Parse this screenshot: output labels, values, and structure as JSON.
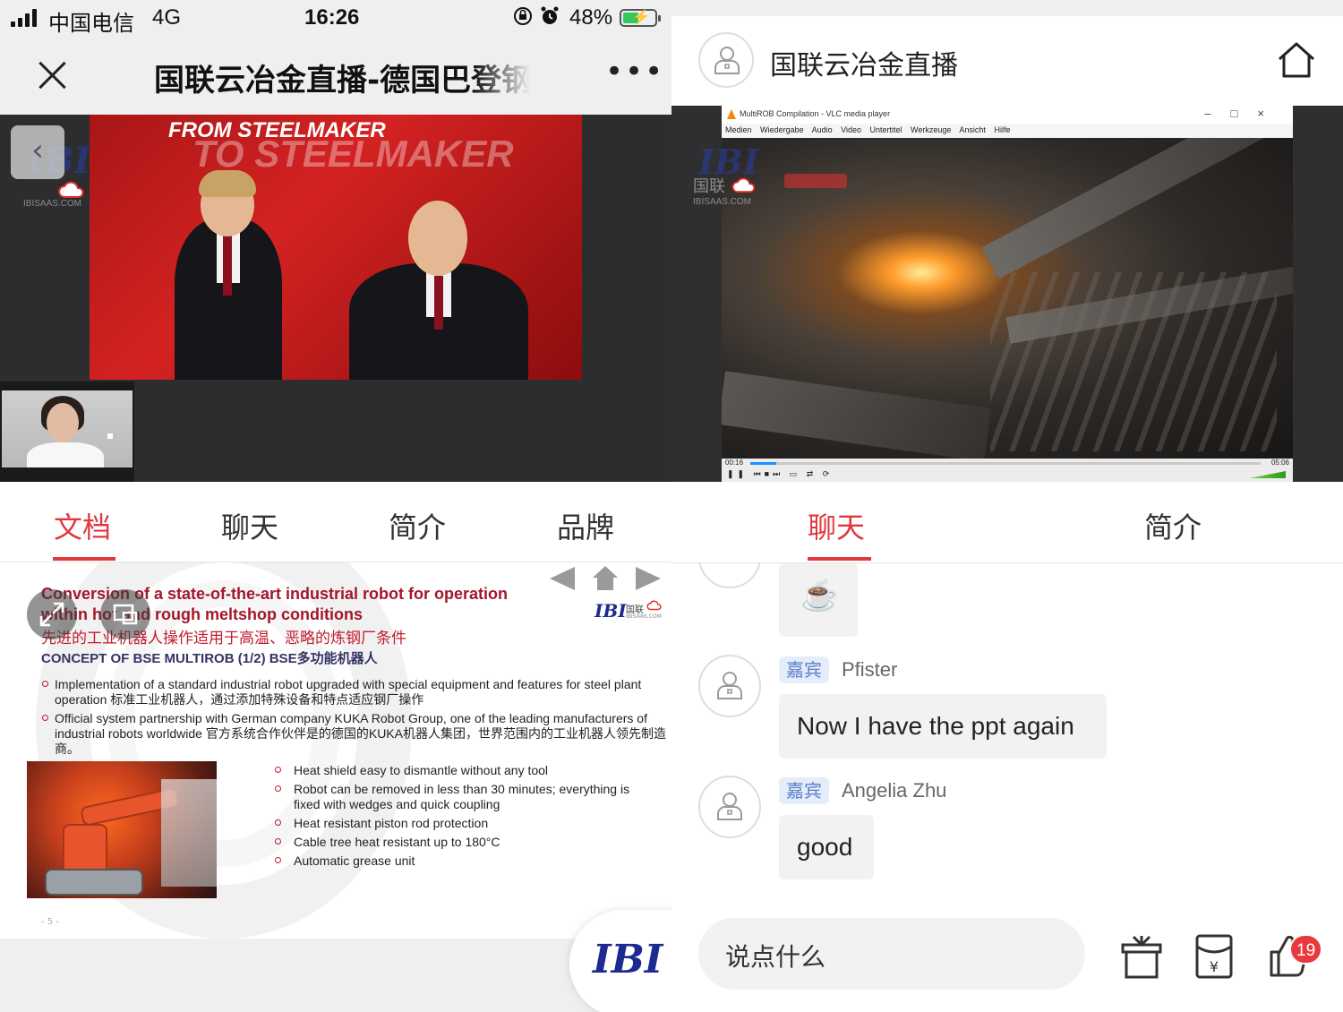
{
  "status_bar": {
    "carrier": "中国电信",
    "network": "4G",
    "time": "16:26",
    "battery": "48%"
  },
  "left_nav": {
    "title": "国联云冶金直播-德国巴登钢"
  },
  "left_video": {
    "stage_line1": "FROM STEELMAKER",
    "stage_line2": "TO STEELMAKER",
    "watermark_logo": "IBI",
    "watermark_domain": "IBISAAS.COM"
  },
  "left_tabs": [
    "文档",
    "聊天",
    "简介",
    "品牌"
  ],
  "document": {
    "title_en": "Conversion of a state-of-the-art industrial robot for operation within hot and rough meltshop conditions",
    "title_cn": "先进的工业机器人操作适用于高温、恶略的炼钢厂条件",
    "concept": "CONCEPT OF BSE MULTIROB (1/2) BSE多功能机器人",
    "logo": "IBI",
    "logo_cn": "国联",
    "logo_domain": "IBISAAS.COM",
    "bullets": [
      "Implementation of a standard industrial robot upgraded with special equipment and features for steel plant operation 标准工业机器人，通过添加特殊设备和特点适应钢厂操作",
      "Official system partnership with German company KUKA Robot Group, one of the leading manufacturers of industrial robots worldwide 官方系统合作伙伴是的德国的KUKA机器人集团，世界范围内的工业机器人领先制造商。"
    ],
    "features": [
      "Heat shield easy to dismantle without any tool",
      "Robot can be removed in less than 30 minutes; everything is fixed with wedges and quick coupling",
      "Heat resistant piston rod protection",
      "Cable tree heat resistant up to 180°C",
      "Automatic grease unit"
    ],
    "page_num": "- 5 -"
  },
  "float_logo": "IBI",
  "right_header": {
    "title": "国联云冶金直播"
  },
  "vlc": {
    "title": "MultiROB Compilation - VLC media player",
    "menu": [
      "Medien",
      "Wiedergabe",
      "Audio",
      "Video",
      "Untertitel",
      "Werkzeuge",
      "Ansicht",
      "Hilfe"
    ],
    "time_elapsed": "00:16",
    "time_total": "05:06",
    "progress": 0.05,
    "watermark_logo": "IBI",
    "watermark_cn": "国联",
    "watermark_domain": "IBISAAS.COM"
  },
  "right_tabs": [
    "聊天",
    "简介"
  ],
  "chat": [
    {
      "tag": "",
      "name": "",
      "message": "☕"
    },
    {
      "tag": "嘉宾",
      "name": "Pfister",
      "message": "Now I have the ppt again"
    },
    {
      "tag": "嘉宾",
      "name": "Angelia Zhu",
      "message": "good"
    }
  ],
  "composer": {
    "placeholder": "说点什么",
    "like_count": "19"
  }
}
